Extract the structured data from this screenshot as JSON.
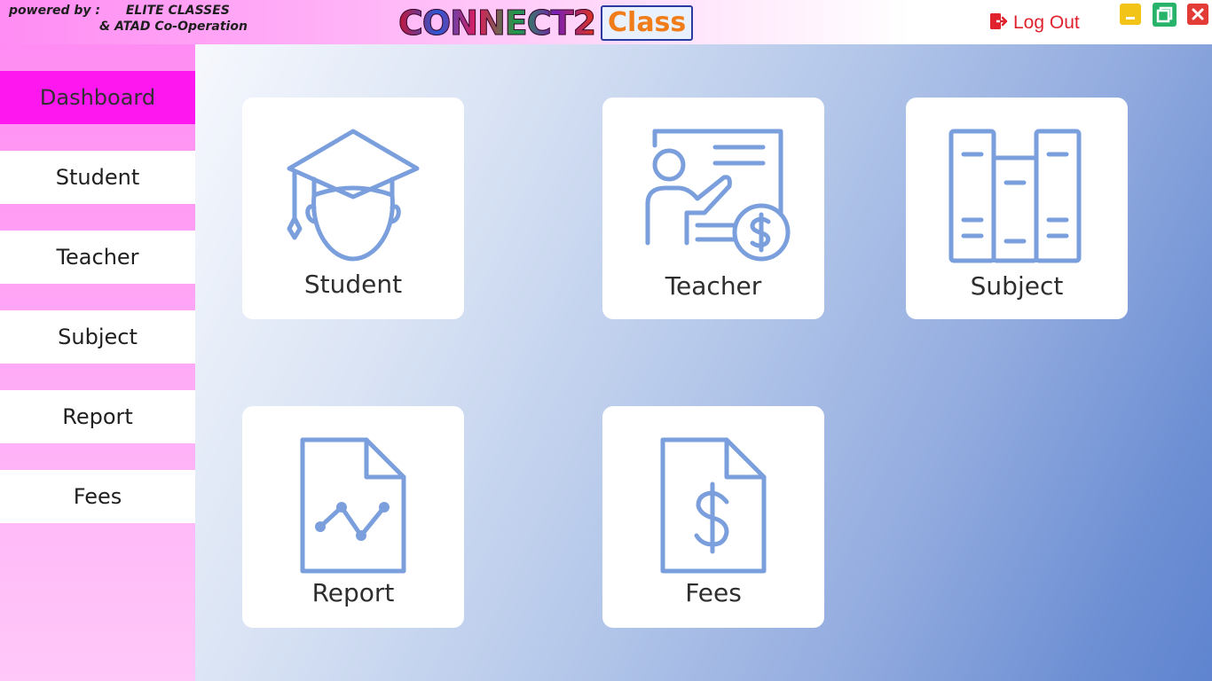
{
  "header": {
    "powered_label": "powered by :",
    "powered_org": "ELITE CLASSES",
    "powered_line2": "& ATAD Co-Operation",
    "logo_main": "CONNECT2",
    "logo_sub": "Class",
    "logout_label": "Log Out",
    "logout_icon": "logout-icon"
  },
  "window_controls": [
    "minimize-icon",
    "maximize-icon",
    "close-icon"
  ],
  "sidebar": {
    "items": [
      {
        "label": "Dashboard",
        "active": true
      },
      {
        "label": "Student"
      },
      {
        "label": "Teacher"
      },
      {
        "label": "Subject"
      },
      {
        "label": "Report"
      },
      {
        "label": "Fees"
      }
    ]
  },
  "cards": [
    {
      "label": "Student",
      "icon": "graduate-icon"
    },
    {
      "label": "Teacher",
      "icon": "teacher-board-icon"
    },
    {
      "label": "Subject",
      "icon": "books-icon"
    },
    {
      "label": "Report",
      "icon": "report-chart-icon"
    },
    {
      "label": "Fees",
      "icon": "fees-document-icon"
    }
  ],
  "colors": {
    "sidebar_active": "#ff17f0",
    "icon_blue": "#7b9fdc",
    "logout_red": "#e0222e",
    "minimize_yellow": "#f2c418",
    "maximize_green": "#27b46a",
    "close_red": "#e33b36"
  }
}
